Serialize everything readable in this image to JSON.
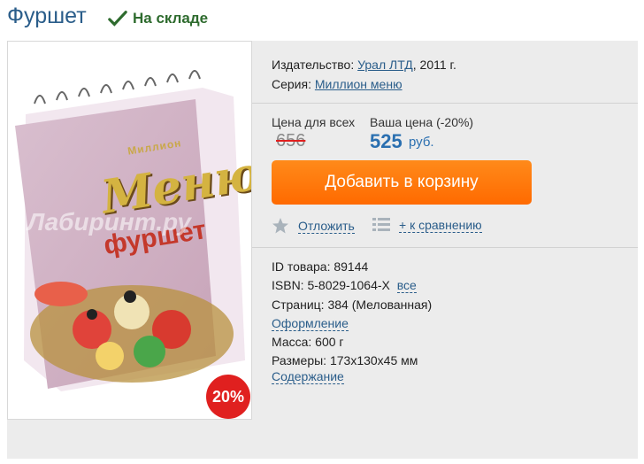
{
  "product": {
    "title": "Фуршет",
    "stock_status": "На складе",
    "discount_badge": "20%",
    "cover_text": {
      "series": "Миллион",
      "brand": "Меню",
      "title": "фуршет",
      "watermark": "Лабиринт.ру"
    }
  },
  "publisher": {
    "label": "Издательство:",
    "name": "Урал ЛТД",
    "year": ", 2011 г."
  },
  "series": {
    "label": "Серия:",
    "name": "Миллион меню"
  },
  "prices": {
    "regular_label": "Цена для всех",
    "regular_value": "656",
    "your_label": "Ваша цена (-20%)",
    "your_value": "525",
    "currency": "руб."
  },
  "actions": {
    "add_to_cart": "Добавить в корзину",
    "postpone": "Отложить",
    "compare": "+ к сравнению"
  },
  "details": {
    "id_line": "ID товара: 89144",
    "isbn_line": "ISBN: 5-8029-1064-X",
    "isbn_all": "все",
    "pages_line": "Страниц: 384 (Мелованная)",
    "design_link": "Оформление",
    "weight_line": "Масса: 600 г",
    "size_line": "Размеры: 173x130x45 мм",
    "contents_link": "Содержание"
  },
  "colors": {
    "title": "#2a5d8a",
    "stock": "#2e6b2e",
    "price_blue": "#2a6fb0",
    "button_orange": "#ff7a0a",
    "badge_red": "#e0201f"
  }
}
